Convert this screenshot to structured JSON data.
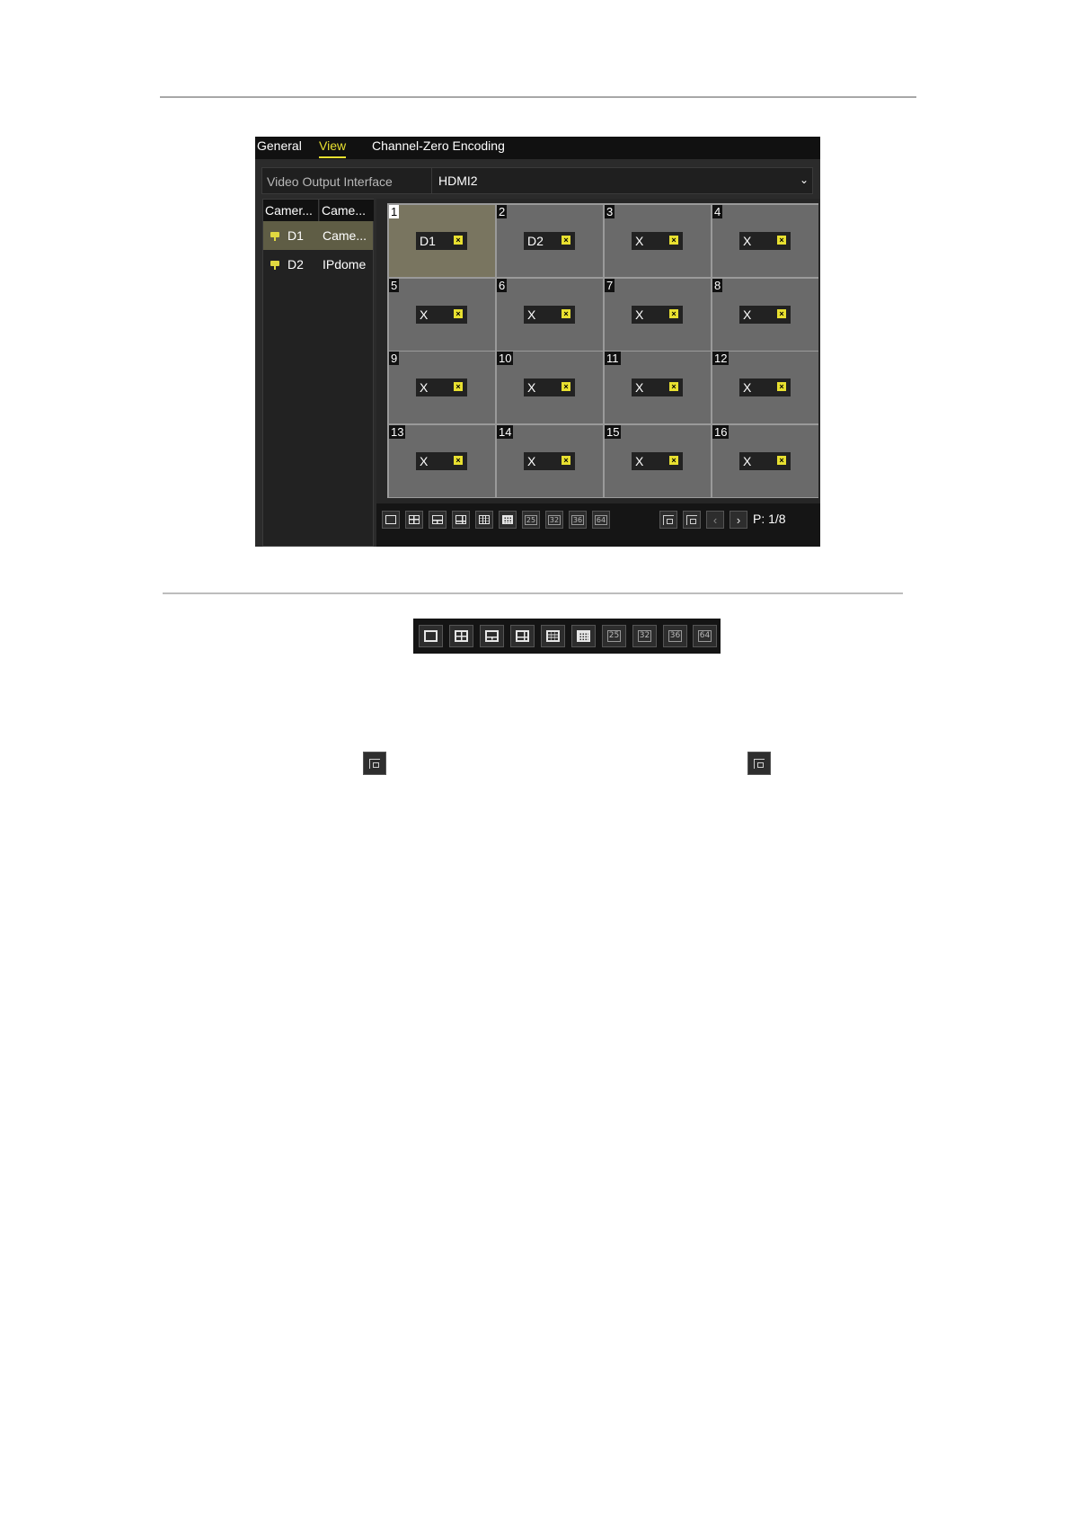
{
  "tabs": [
    {
      "label": "General",
      "active": false
    },
    {
      "label": "View",
      "active": true
    },
    {
      "label": "Channel-Zero Encoding",
      "active": false
    }
  ],
  "video_output": {
    "label": "Video Output Interface",
    "value": "HDMI2"
  },
  "camera_list": {
    "headers": [
      "Camer...",
      "Came..."
    ],
    "rows": [
      {
        "id": "D1",
        "name": "Came...",
        "selected": true
      },
      {
        "id": "D2",
        "name": "IPdome",
        "selected": false
      }
    ]
  },
  "grid": {
    "cells": [
      {
        "num": "1",
        "label": "D1"
      },
      {
        "num": "2",
        "label": "D2"
      },
      {
        "num": "3",
        "label": "X"
      },
      {
        "num": "4",
        "label": "X"
      },
      {
        "num": "5",
        "label": "X"
      },
      {
        "num": "6",
        "label": "X"
      },
      {
        "num": "7",
        "label": "X"
      },
      {
        "num": "8",
        "label": "X"
      },
      {
        "num": "9",
        "label": "X"
      },
      {
        "num": "10",
        "label": "X"
      },
      {
        "num": "11",
        "label": "X"
      },
      {
        "num": "12",
        "label": "X"
      },
      {
        "num": "13",
        "label": "X"
      },
      {
        "num": "14",
        "label": "X"
      },
      {
        "num": "15",
        "label": "X"
      },
      {
        "num": "16",
        "label": "X"
      }
    ],
    "selected_cell": "1"
  },
  "toolbar": {
    "layout_labels": [
      "25",
      "32",
      "36",
      "64"
    ],
    "page_indicator": "P: 1/8",
    "prev_glyph": "‹",
    "next_glyph": "›"
  },
  "colors": {
    "accent": "#e8e030",
    "background": "#2b2b2b",
    "cell": "#6a6a6a"
  }
}
